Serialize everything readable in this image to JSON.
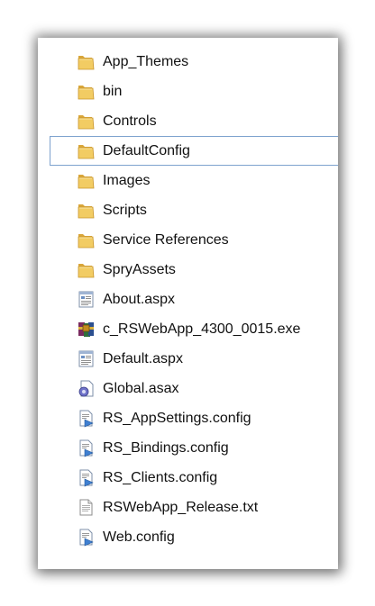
{
  "files": [
    {
      "name": "App_Themes",
      "icon": "folder-icon",
      "type": "folder",
      "selected": false
    },
    {
      "name": "bin",
      "icon": "folder-icon",
      "type": "folder",
      "selected": false
    },
    {
      "name": "Controls",
      "icon": "folder-icon",
      "type": "folder",
      "selected": false
    },
    {
      "name": "DefaultConfig",
      "icon": "folder-icon",
      "type": "folder",
      "selected": true
    },
    {
      "name": "Images",
      "icon": "folder-icon",
      "type": "folder",
      "selected": false
    },
    {
      "name": "Scripts",
      "icon": "folder-icon",
      "type": "folder",
      "selected": false
    },
    {
      "name": "Service References",
      "icon": "folder-icon",
      "type": "folder",
      "selected": false
    },
    {
      "name": "SpryAssets",
      "icon": "folder-icon",
      "type": "folder",
      "selected": false
    },
    {
      "name": "About.aspx",
      "icon": "aspx-file-icon",
      "type": "aspx",
      "selected": false
    },
    {
      "name": "c_RSWebApp_4300_0015.exe",
      "icon": "winrar-sfx-icon",
      "type": "exe",
      "selected": false
    },
    {
      "name": "Default.aspx",
      "icon": "aspx-file-icon",
      "type": "aspx",
      "selected": false
    },
    {
      "name": "Global.asax",
      "icon": "asax-file-icon",
      "type": "asax",
      "selected": false
    },
    {
      "name": "RS_AppSettings.config",
      "icon": "config-file-icon",
      "type": "config",
      "selected": false
    },
    {
      "name": "RS_Bindings.config",
      "icon": "config-file-icon",
      "type": "config",
      "selected": false
    },
    {
      "name": "RS_Clients.config",
      "icon": "config-file-icon",
      "type": "config",
      "selected": false
    },
    {
      "name": "RSWebApp_Release.txt",
      "icon": "text-file-icon",
      "type": "txt",
      "selected": false
    },
    {
      "name": "Web.config",
      "icon": "config-file-icon",
      "type": "config",
      "selected": false
    }
  ],
  "colors": {
    "folder": "#e8b94a",
    "selection_border": "#7da2ce"
  }
}
